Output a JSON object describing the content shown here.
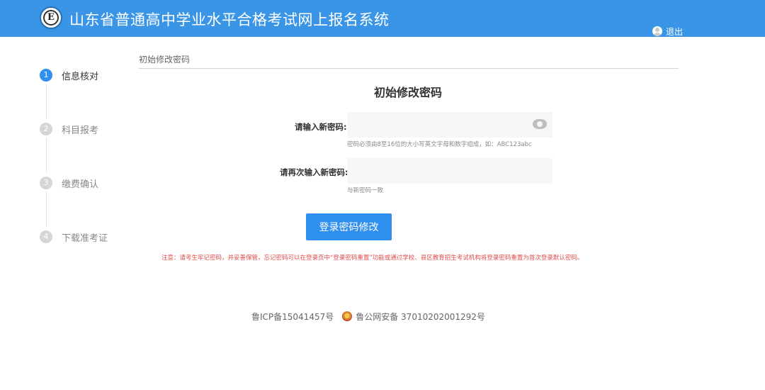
{
  "header": {
    "logo_letter": "E",
    "title": "山东省普通高中学业水平合格考试网上报名系统",
    "logout_label": "退出"
  },
  "steps": [
    {
      "num": "1",
      "label": "信息核对",
      "active": true
    },
    {
      "num": "2",
      "label": "科目报考",
      "active": false
    },
    {
      "num": "3",
      "label": "缴费确认",
      "active": false
    },
    {
      "num": "4",
      "label": "下载准考证",
      "active": false
    }
  ],
  "breadcrumb": "初始修改密码",
  "form": {
    "title": "初始修改密码",
    "new_password_label": "请输入新密码:",
    "new_password_value": "",
    "new_password_hint": "密码必须由8至16位的大小写英文字母和数字组成，如：ABC123abc",
    "confirm_password_label": "请再次输入新密码:",
    "confirm_password_value": "",
    "confirm_password_hint": "与新密码一致",
    "submit_label": "登录密码修改"
  },
  "notice": "注意：请考生牢记密码，并妥善保管，忘记密码可以在登录页中“登录密码重置”功能或通过学校、县区教育招生考试机构将登录密码重置为首次登录默认密码。",
  "footer": {
    "icp": "鲁ICP备15041457号",
    "police": "鲁公网安备 37010202001292号"
  },
  "colors": {
    "header_bg": "#3a95e6",
    "accent": "#2f8ff0",
    "notice": "#e24c4c"
  }
}
